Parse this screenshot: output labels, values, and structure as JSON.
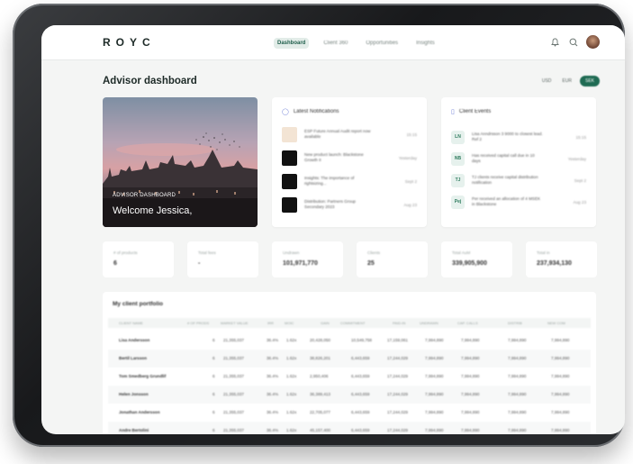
{
  "app": {
    "logo": "ROYC"
  },
  "nav": [
    {
      "label": "Dashboard",
      "active": true
    },
    {
      "label": "Client 360",
      "active": false
    },
    {
      "label": "Opportunities",
      "active": false
    },
    {
      "label": "Insights",
      "active": false
    }
  ],
  "header": {
    "title": "Advisor dashboard",
    "currencies": [
      {
        "label": "USD",
        "active": false
      },
      {
        "label": "EUR",
        "active": false
      },
      {
        "label": "SEK",
        "active": true
      }
    ]
  },
  "hero": {
    "subtitle": "ADVISOR DASHBOARD",
    "title": "Welcome Jessica,"
  },
  "notifications": {
    "title": "Latest Notifications",
    "items": [
      {
        "text": "ESP Future Annual Audit report now available",
        "meta": "15:15",
        "thumb": "#f3e4d4"
      },
      {
        "text": "New product launch: Blackstone Growth II",
        "meta": "Yesterday",
        "thumb": "#111111"
      },
      {
        "text": "Insights: The importance of rightsizing...",
        "meta": "Sept 2",
        "thumb": "#111111"
      },
      {
        "text": "Distribution: Partners Group Secondary 2023",
        "meta": "Aug 23",
        "thumb": "#111111"
      }
    ]
  },
  "events": {
    "title": "Client Events",
    "items": [
      {
        "badge": "LN",
        "text": "Lisa Anndrsson 3 9000 to closest lead. Ref 2",
        "meta": "15:15"
      },
      {
        "badge": "NB",
        "text": "Has received capital call due in 10 days",
        "meta": "Yesterday"
      },
      {
        "badge": "TJ",
        "text": "TJ clients receive capital distribution notification",
        "meta": "Sept 2"
      },
      {
        "badge": "Pej",
        "text": "Per received an allocation of 4 MSEK in Blackstone",
        "meta": "Aug 23"
      }
    ]
  },
  "stats": [
    {
      "label": "# of products",
      "value": "6"
    },
    {
      "label": "Total fees",
      "value": "-"
    },
    {
      "label": "Undrawn",
      "value": "101,971,770"
    },
    {
      "label": "Clients",
      "value": "25"
    },
    {
      "label": "Total AuM",
      "value": "339,905,900"
    },
    {
      "label": "Total in",
      "value": "237,934,130"
    }
  ],
  "portfolio": {
    "title": "My client portfolio",
    "columns": [
      "CLIENT NAME",
      "# OF PRODS",
      "MARKET VALUE",
      "IRR",
      "MOIC",
      "GAIN",
      "COMMITMENT",
      "PAID-IN",
      "UNDRAWN",
      "CAP. CALLS",
      "DISTRIB",
      "NEW COM"
    ],
    "rows": [
      {
        "name": "Lisa Andersson",
        "prods": "6",
        "mv": "21,355,037",
        "irr": "36.4%",
        "moic": "1.62x",
        "gain": "20,428,050",
        "commit": "10,549,758",
        "paid": "17,159,061",
        "undrawn": "7,994,890",
        "calls": "7,994,890",
        "dist": "7,994,890",
        "newc": "7,994,890"
      },
      {
        "name": "Bertil Larsson",
        "prods": "6",
        "mv": "21,355,037",
        "irr": "36.4%",
        "moic": "1.62x",
        "gain": "38,826,201",
        "commit": "6,443,659",
        "paid": "17,244,029",
        "undrawn": "7,994,890",
        "calls": "7,994,890",
        "dist": "7,994,890",
        "newc": "7,994,890"
      },
      {
        "name": "Tom Smedberg Grundlif",
        "prods": "6",
        "mv": "21,355,037",
        "irr": "36.4%",
        "moic": "1.62x",
        "gain": "2,950,406",
        "commit": "6,443,659",
        "paid": "17,244,029",
        "undrawn": "7,994,890",
        "calls": "7,994,890",
        "dist": "7,994,890",
        "newc": "7,994,890"
      },
      {
        "name": "Helen Jonsson",
        "prods": "6",
        "mv": "21,355,037",
        "irr": "36.4%",
        "moic": "1.62x",
        "gain": "36,389,413",
        "commit": "6,443,659",
        "paid": "17,244,029",
        "undrawn": "7,994,890",
        "calls": "7,994,890",
        "dist": "7,994,890",
        "newc": "7,994,890"
      },
      {
        "name": "Jonathan Andersson",
        "prods": "6",
        "mv": "21,355,037",
        "irr": "36.4%",
        "moic": "1.62x",
        "gain": "22,705,077",
        "commit": "6,443,659",
        "paid": "17,244,029",
        "undrawn": "7,994,890",
        "calls": "7,994,890",
        "dist": "7,994,890",
        "newc": "7,994,890"
      },
      {
        "name": "Andre Bertolini",
        "prods": "6",
        "mv": "21,355,037",
        "irr": "36.4%",
        "moic": "1.62x",
        "gain": "45,157,400",
        "commit": "6,443,659",
        "paid": "17,244,029",
        "undrawn": "7,994,890",
        "calls": "7,994,890",
        "dist": "7,994,890",
        "newc": "7,994,890"
      }
    ]
  },
  "colors": {
    "accent": "#1f6b53",
    "background": "#f4f5f4",
    "panel": "#ffffff"
  },
  "icons": {
    "notifications": "bell-icon",
    "search": "search-icon"
  }
}
